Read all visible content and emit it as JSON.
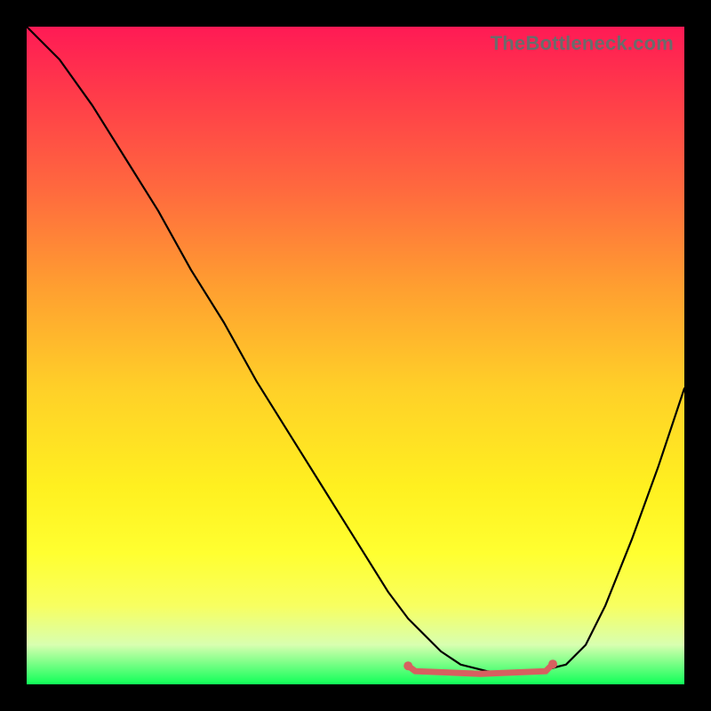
{
  "watermark": "TheBottleneck.com",
  "chart_data": {
    "type": "line",
    "title": "",
    "xlabel": "",
    "ylabel": "",
    "xlim": [
      0,
      100
    ],
    "ylim": [
      0,
      100
    ],
    "grid": false,
    "series": [
      {
        "name": "curve",
        "x": [
          0,
          5,
          10,
          15,
          20,
          25,
          30,
          35,
          40,
          45,
          50,
          55,
          58,
          60,
          63,
          66,
          70,
          74,
          78,
          80,
          82,
          85,
          88,
          92,
          96,
          100
        ],
        "y": [
          100,
          95,
          88,
          80,
          72,
          63,
          55,
          46,
          38,
          30,
          22,
          14,
          10,
          8,
          5,
          3,
          2,
          1.5,
          2,
          2.5,
          3,
          6,
          12,
          22,
          33,
          45
        ]
      }
    ],
    "highlight": {
      "name": "optimal-zone",
      "x_start": 58,
      "x_end": 80,
      "y_level": 2
    },
    "colors": {
      "gradient_top": "#ff1a55",
      "gradient_bottom": "#10ff58",
      "curve": "#000000",
      "highlight": "#d76060"
    }
  }
}
